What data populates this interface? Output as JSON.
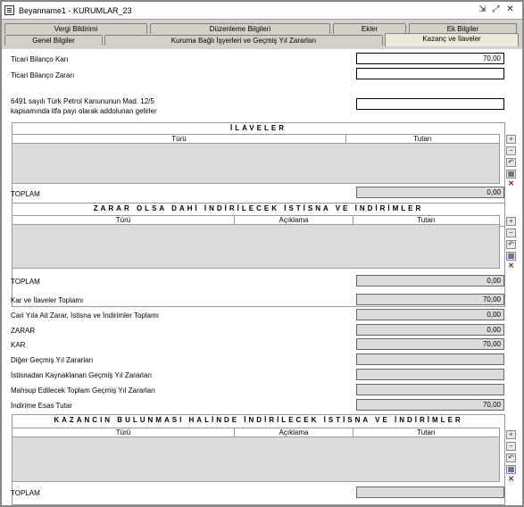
{
  "window": {
    "title": "Beyanname1 - KURUMLAR_23"
  },
  "tabs_back": [
    "Vergi Bildirimi",
    "Düzenleme Bilgileri",
    "Ekler",
    "Ek Bilgiler"
  ],
  "tabs_front": [
    "Genel Bilgiler",
    "Kuruma Bağlı İşyerleri ve Geçmiş Yıl Zararları",
    "Kazanç ve İlaveler"
  ],
  "top_fields": {
    "ticari_kar_label": "Ticari Bilanço Karı",
    "ticari_kar_value": "70,00",
    "ticari_zarar_label": "Ticari Bilanço Zararı",
    "ticari_zarar_value": "",
    "petrol_label_1": "6491 sayılı Türk Petrol Kanununun Mad. 12/5",
    "petrol_label_2": "kapsamında itfa payı olarak addolunan gelirler",
    "petrol_value": ""
  },
  "ilaveler": {
    "title": "İLAVELER",
    "columns": [
      "Türü",
      "Tutarı"
    ],
    "total_label": "TOPLAM",
    "total_value": "0,00"
  },
  "zarar": {
    "title": "ZARAR OLSA DAHİ İNDİRİLECEK İSTİSNA VE İNDİRİMLER",
    "columns": [
      "Türü",
      "Açıklama",
      "Tutarı"
    ],
    "total_label": "TOPLAM",
    "total_value": "0,00"
  },
  "summary": [
    {
      "label": "Kar ve İlaveler Toplamı",
      "value": "70,00"
    },
    {
      "label": "Cari Yıla Ait Zarar, İstisna ve İndirimler Toplamı",
      "value": "0,00"
    },
    {
      "label": "ZARAR",
      "value": "0,00"
    },
    {
      "label": "KAR",
      "value": "70,00"
    },
    {
      "label": "Diğer Geçmiş Yıl Zararları",
      "value": ""
    },
    {
      "label": "İstisnadan Kaynaklanan Geçmiş Yıl Zararları",
      "value": ""
    },
    {
      "label": "Mahsup Edilecek Toplam Geçmiş Yıl Zararları",
      "value": ""
    },
    {
      "label": "İndirime Esas Tutar",
      "value": "70,00"
    }
  ],
  "kazanc": {
    "title": "KAZANCIN BULUNMASI HALİNDE İNDİRİLECEK İSTİSNA VE İNDİRİMLER",
    "columns": [
      "Türü",
      "Açıklama",
      "Tutarı"
    ],
    "total_label": "TOPLAM",
    "total_value": ""
  },
  "side_buttons": {
    "add": "+",
    "remove": "−",
    "undo": "↶",
    "save": "▦",
    "delete": "✕"
  },
  "titlebar_buttons": {
    "restore": "⇲",
    "maximize": "⤢",
    "close": "✕"
  }
}
